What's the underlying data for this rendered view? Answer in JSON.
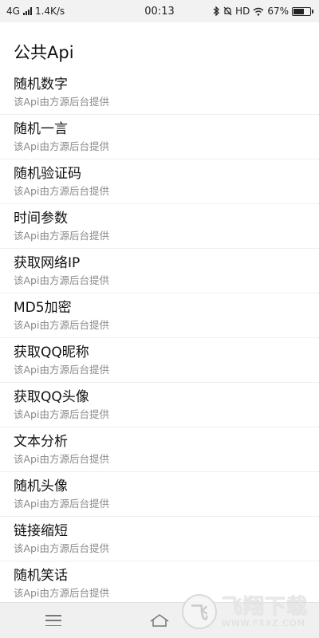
{
  "status_bar": {
    "network": "4G",
    "speed": "1.4K/s",
    "time": "00:13",
    "icons": [
      "signal-icon",
      "bluetooth-icon",
      "mute-icon",
      "hd-badge",
      "wifi-icon",
      "battery-icon"
    ],
    "hd": "HD",
    "battery_percent": "67%",
    "battery_level": 0.67
  },
  "page": {
    "title": "公共Api"
  },
  "api_list": [
    {
      "name": "随机数字",
      "desc": "该Api由方源后台提供"
    },
    {
      "name": "随机一言",
      "desc": "该Api由方源后台提供"
    },
    {
      "name": "随机验证码",
      "desc": "该Api由方源后台提供"
    },
    {
      "name": "时间参数",
      "desc": "该Api由方源后台提供"
    },
    {
      "name": "获取网络IP",
      "desc": "该Api由方源后台提供"
    },
    {
      "name": "MD5加密",
      "desc": "该Api由方源后台提供"
    },
    {
      "name": "获取QQ昵称",
      "desc": "该Api由方源后台提供"
    },
    {
      "name": "获取QQ头像",
      "desc": "该Api由方源后台提供"
    },
    {
      "name": "文本分析",
      "desc": "该Api由方源后台提供"
    },
    {
      "name": "随机头像",
      "desc": "该Api由方源后台提供"
    },
    {
      "name": "链接缩短",
      "desc": "该Api由方源后台提供"
    },
    {
      "name": "随机笑话",
      "desc": "该Api由方源后台提供"
    }
  ],
  "nav_bar": {
    "icons": [
      "menu-icon",
      "home-icon"
    ]
  },
  "watermark": {
    "main": "飞翔下载",
    "sub": "WWW.FXXZ.COM"
  }
}
